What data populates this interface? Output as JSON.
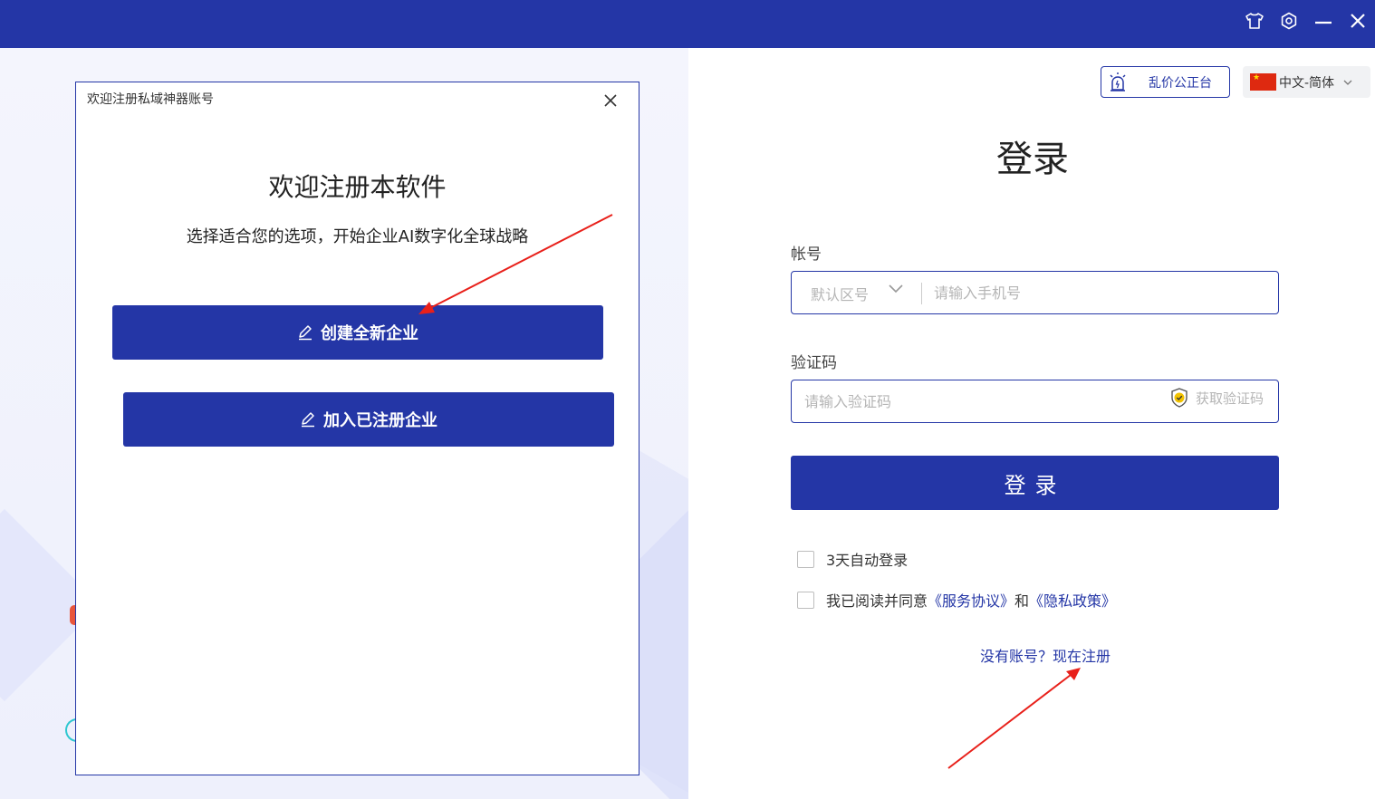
{
  "dialog": {
    "title": "欢迎注册私域神器账号",
    "heading": "欢迎注册本软件",
    "subheading": "选择适合您的选项，开始企业AI数字化全球战略",
    "buttons": [
      {
        "label": "创建全新企业"
      },
      {
        "label": "加入已注册企业"
      }
    ]
  },
  "header": {
    "platform_label": "乱价公正台",
    "language_label": "中文-简体"
  },
  "login": {
    "title": "登录",
    "account_label": "帐号",
    "area_code_placeholder": "默认区号",
    "phone_placeholder": "请输入手机号",
    "code_label": "验证码",
    "code_placeholder": "请输入验证码",
    "get_code_label": "获取验证码",
    "login_button": "登录",
    "auto_login_label": "3天自动登录",
    "agree_prefix": "我已阅读并同意",
    "service_agreement": "《服务协议》",
    "agree_and": "和",
    "privacy_policy": "《隐私政策》",
    "register_link": "没有账号？现在注册"
  },
  "colors": {
    "brand": "#2436a6",
    "annotation": "#e8201a"
  },
  "icons": [
    "shirt-icon",
    "settings-icon",
    "minimize-icon",
    "close-icon",
    "pen-icon",
    "alarm-icon",
    "china-flag-icon",
    "shield-check-icon",
    "chevron-down-icon"
  ]
}
